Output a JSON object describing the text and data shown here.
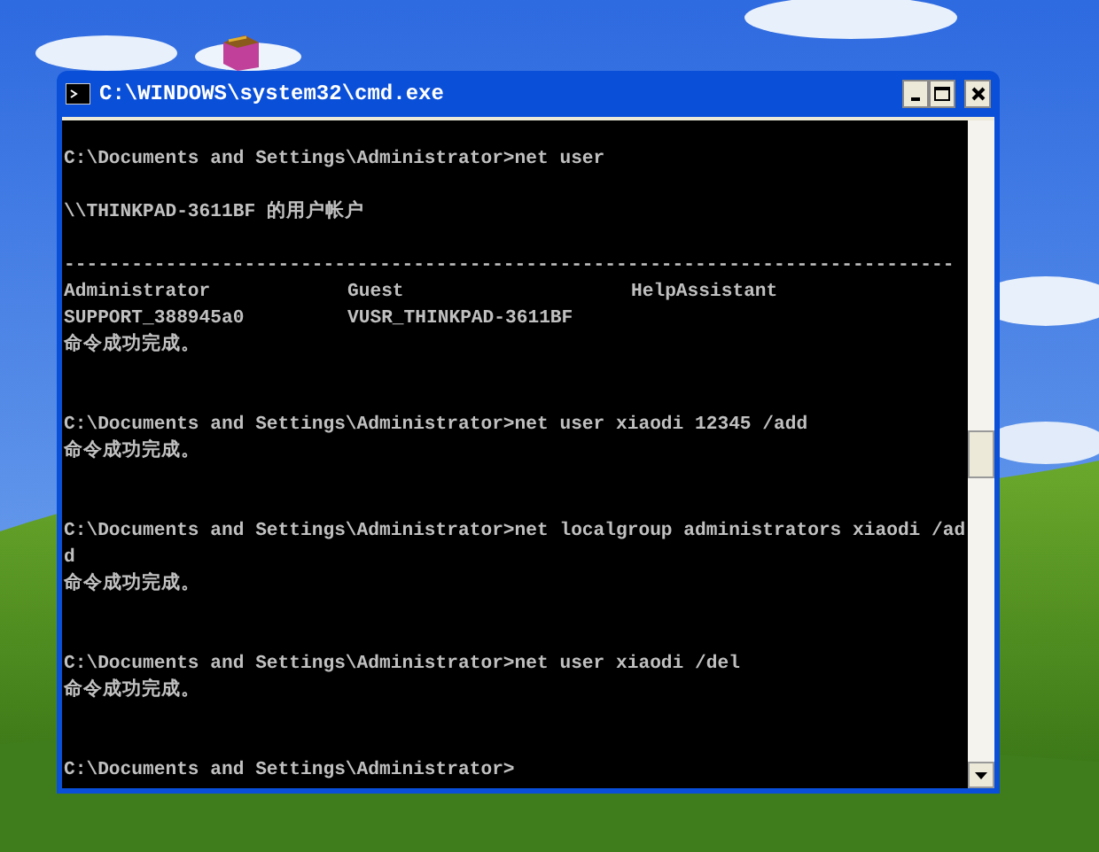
{
  "window": {
    "title": "C:\\WINDOWS\\system32\\cmd.exe"
  },
  "console": {
    "lines": [
      {
        "kind": "blank"
      },
      {
        "kind": "text",
        "text": "C:\\Documents and Settings\\Administrator>net user"
      },
      {
        "kind": "blank"
      },
      {
        "kind": "text",
        "text": "\\\\THINKPAD-3611BF 的用户帐户"
      },
      {
        "kind": "blank"
      },
      {
        "kind": "text",
        "text": "-------------------------------------------------------------------------------"
      },
      {
        "kind": "accounts",
        "cells": [
          "Administrator",
          "Guest",
          "HelpAssistant"
        ]
      },
      {
        "kind": "accounts",
        "cells": [
          "SUPPORT_388945a0",
          "VUSR_THINKPAD-3611BF"
        ]
      },
      {
        "kind": "text",
        "text": "命令成功完成。"
      },
      {
        "kind": "blank"
      },
      {
        "kind": "blank"
      },
      {
        "kind": "text",
        "text": "C:\\Documents and Settings\\Administrator>net user xiaodi 12345 /add"
      },
      {
        "kind": "text",
        "text": "命令成功完成。"
      },
      {
        "kind": "blank"
      },
      {
        "kind": "blank"
      },
      {
        "kind": "text",
        "text": "C:\\Documents and Settings\\Administrator>net localgroup administrators xiaodi /ad"
      },
      {
        "kind": "text",
        "text": "d"
      },
      {
        "kind": "text",
        "text": "命令成功完成。"
      },
      {
        "kind": "blank"
      },
      {
        "kind": "blank"
      },
      {
        "kind": "text",
        "text": "C:\\Documents and Settings\\Administrator>net user xiaodi /del"
      },
      {
        "kind": "text",
        "text": "命令成功完成。"
      },
      {
        "kind": "blank"
      },
      {
        "kind": "blank"
      },
      {
        "kind": "text",
        "text": "C:\\Documents and Settings\\Administrator>"
      }
    ]
  }
}
